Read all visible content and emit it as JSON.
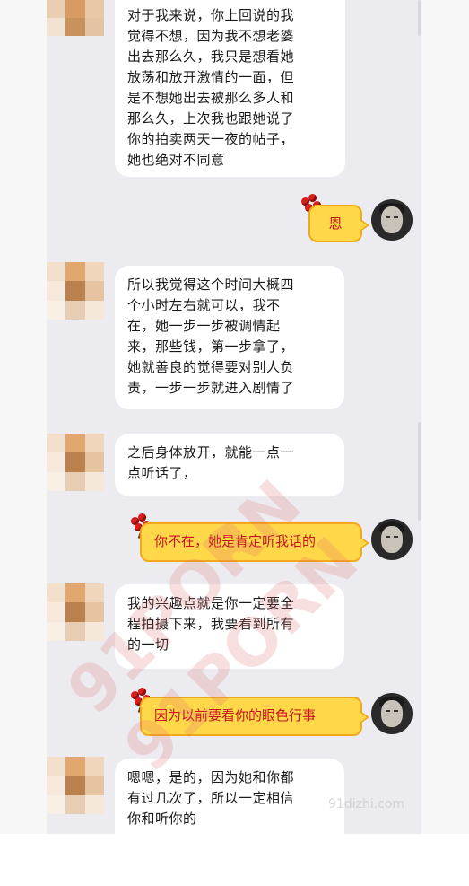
{
  "messages": [
    {
      "side": "in",
      "text": "对于我来说，你上回说的我\n觉得不想，因为我不想老婆\n出去那么久，我只是想看她\n放荡和放开激情的一面，但\n是不想她出去被那么多人和\n那么久，上次我也跟她说了\n你的拍卖两天一夜的帖子，\n她也绝对不同意"
    },
    {
      "side": "out",
      "text": "恩"
    },
    {
      "side": "in",
      "text": "所以我觉得这个时间大概四\n个小时左右就可以，我不\n在，她一步一步被调情起\n来，那些钱，第一步拿了，\n她就善良的觉得要对别人负\n责，一步一步就进入剧情了"
    },
    {
      "side": "in",
      "text": "之后身体放开，就能一点一\n点听话了，"
    },
    {
      "side": "out",
      "text": "你不在，她是肯定听我话的"
    },
    {
      "side": "in",
      "text": "我的兴趣点就是你一定要全\n程拍摄下来，我要看到所有\n的一切"
    },
    {
      "side": "out",
      "text": "因为以前要看你的眼色行事"
    },
    {
      "side": "in",
      "text": "嗯嗯，是的，因为她和你都\n有过几次了，所以一定相信\n你和听你的"
    }
  ],
  "watermark": {
    "line1": "91PORN",
    "line2": "91PORN",
    "corner": "91dizhi.com"
  },
  "colors": {
    "panel": "#ececf0",
    "incoming": "#ffffff",
    "outgoing": "#ffd84a",
    "outgoing_text": "#c8121c"
  }
}
